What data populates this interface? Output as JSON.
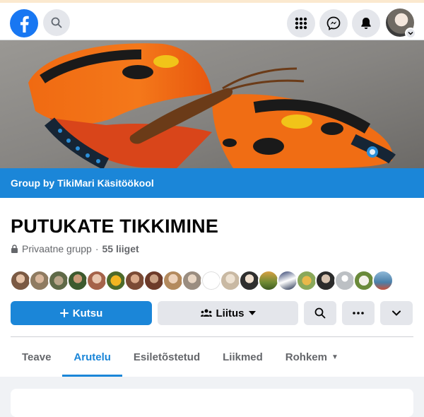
{
  "topbar": {
    "logo_icon": "facebook-logo-icon",
    "search_icon": "search-icon",
    "menu_icon": "grid-menu-icon",
    "messenger_icon": "messenger-icon",
    "notifications_icon": "bell-icon",
    "account_icon": "profile-avatar"
  },
  "group": {
    "owner_bar": "Group by TikiMari Käsitöökool",
    "title": "PUTUKATE TIKKIMINE",
    "privacy": "Privaatne grupp",
    "separator": "·",
    "members_count": "55 liiget"
  },
  "actions": {
    "invite_label": "Kutsu",
    "join_label": "Liitus"
  },
  "tabs": [
    {
      "label": "Teave",
      "active": false
    },
    {
      "label": "Arutelu",
      "active": true
    },
    {
      "label": "Esiletõstetud",
      "active": false
    },
    {
      "label": "Liikmed",
      "active": false
    },
    {
      "label": "Rohkem",
      "active": false
    }
  ],
  "colors": {
    "brand_blue": "#1b86d8",
    "button_gray": "#e4e6eb",
    "page_bg": "#f0f2f5"
  }
}
